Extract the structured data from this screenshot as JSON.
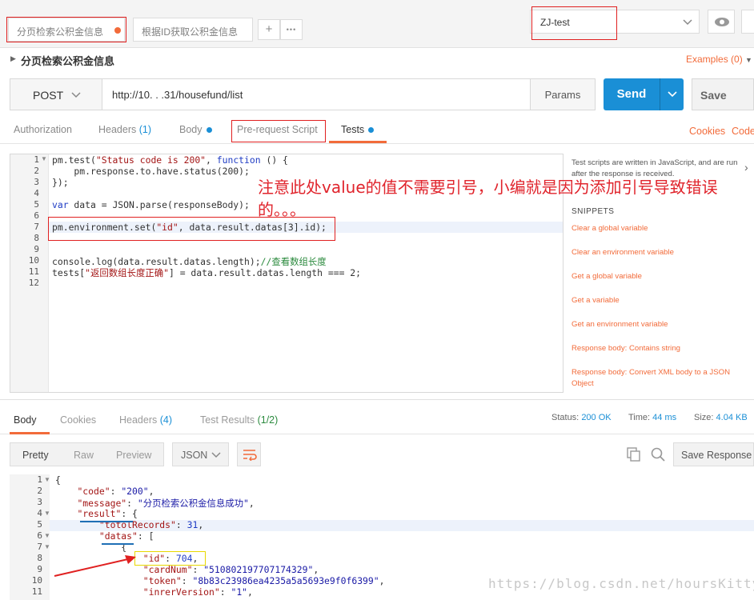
{
  "tabs": {
    "active_label": "分页检索公积金信息",
    "second_label": "根据ID获取公积金信息",
    "add_symbol": "+",
    "more_symbol": "•••"
  },
  "environment": {
    "selected": "ZJ-test"
  },
  "request": {
    "title": "分页检索公积金信息",
    "examples_label": "Examples (0)",
    "method": "POST",
    "url": "http://10.    .  .31/housefund/list",
    "params_label": "Params",
    "send_label": "Send",
    "save_label": "Save"
  },
  "subtabs": {
    "authorization": "Authorization",
    "headers": "Headers",
    "headers_count": "(1)",
    "body": "Body",
    "prerequest": "Pre-request Script",
    "tests": "Tests",
    "cookies": "Cookies",
    "code": "Code"
  },
  "editor": {
    "line_numbers": [
      "1",
      "2",
      "3",
      "4",
      "5",
      "6",
      "7",
      "8",
      "9",
      "10",
      "11",
      "12"
    ],
    "annotation": "注意此处value的值不需要引号，小编就是因为添加引号导致错误的。。。"
  },
  "snippets": {
    "description": "Test scripts are written in JavaScript, and are run after the response is received.",
    "title": "SNIPPETS",
    "items": [
      "Clear a global variable",
      "Clear an environment variable",
      "Get a global variable",
      "Get a variable",
      "Get an environment variable",
      "Response body: Contains string",
      "Response body: Convert XML body to a JSON Object"
    ]
  },
  "response": {
    "tabs": {
      "body": "Body",
      "cookies": "Cookies",
      "headers": "Headers",
      "headers_count": "(4)",
      "test_results": "Test Results",
      "test_results_count": "(1/2)"
    },
    "status_label": "Status:",
    "status_value": "200 OK",
    "time_label": "Time:",
    "time_value": "44 ms",
    "size_label": "Size:",
    "size_value": "4.04 KB",
    "view_pretty": "Pretty",
    "view_raw": "Raw",
    "view_preview": "Preview",
    "format": "JSON",
    "save_response": "Save Response",
    "line_numbers": [
      "1",
      "2",
      "3",
      "4",
      "5",
      "6",
      "7",
      "8",
      "9",
      "10",
      "11"
    ]
  },
  "watermark": "https://blog.csdn.net/hoursKitty",
  "colors": {
    "accent": "#f26b3a",
    "send": "#1a8fd6",
    "annotation": "#e0242c"
  }
}
